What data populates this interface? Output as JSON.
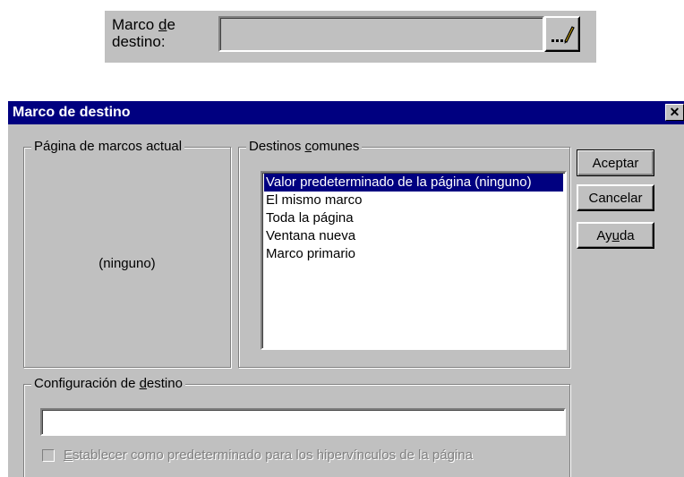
{
  "top_field": {
    "label_line1_pre": "Marco ",
    "label_line1_hot": "d",
    "label_line1_post": "e",
    "label_line2": "destino:",
    "value": "",
    "browse_label": "..."
  },
  "dialog": {
    "title": "Marco de destino",
    "close_glyph": "✕",
    "current_group": {
      "legend": "Página de marcos actual",
      "value": "(ninguno)"
    },
    "common_group": {
      "legend_pre": "Destinos ",
      "legend_hot": "c",
      "legend_post": "omunes",
      "items": [
        "Valor predeterminado de la página (ninguno)",
        "El mismo marco",
        "Toda la página",
        "Ventana nueva",
        "Marco primario"
      ],
      "selected_index": 0
    },
    "config_group": {
      "legend_pre": "Configuración de ",
      "legend_hot": "d",
      "legend_post": "estino",
      "input_value": "",
      "checkbox_hot": "E",
      "checkbox_post": "stablecer como predeterminado para los hipervínculos de la página",
      "checkbox_checked": false
    },
    "buttons": {
      "ok": "Aceptar",
      "cancel": "Cancelar",
      "help_pre": "Ay",
      "help_hot": "u",
      "help_post": "da"
    }
  }
}
